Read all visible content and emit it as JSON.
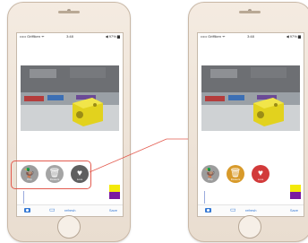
{
  "statusbar": {
    "carrier": "••••• Griffiken ᯤ",
    "time": "3:48",
    "battery": "◀ 97% ▆"
  },
  "filters_left": [
    {
      "icon": "🦆",
      "caption": "Pop",
      "color": "#9c9c9c"
    },
    {
      "icon": "🗑",
      "caption": "Flowers",
      "color": "#a5a5a5"
    },
    {
      "icon": "♥",
      "caption": "Love",
      "color": "#5f5f5f"
    }
  ],
  "filters_right": [
    {
      "icon": "🦆",
      "caption": "Pop",
      "color": "#9c9c9c"
    },
    {
      "icon": "🗑",
      "caption": "Flowers",
      "color": "#d89a2a"
    },
    {
      "icon": "♥",
      "caption": "Love",
      "color": "#d23a3a"
    }
  ],
  "toolbar": {
    "refresh_label": "refresh",
    "save_label": "Save"
  },
  "colors": {
    "accent": "#3478d4",
    "highlight": "#e35b4f",
    "swatch_top": "#f3e90a",
    "swatch_bottom": "#7a1aa0"
  }
}
